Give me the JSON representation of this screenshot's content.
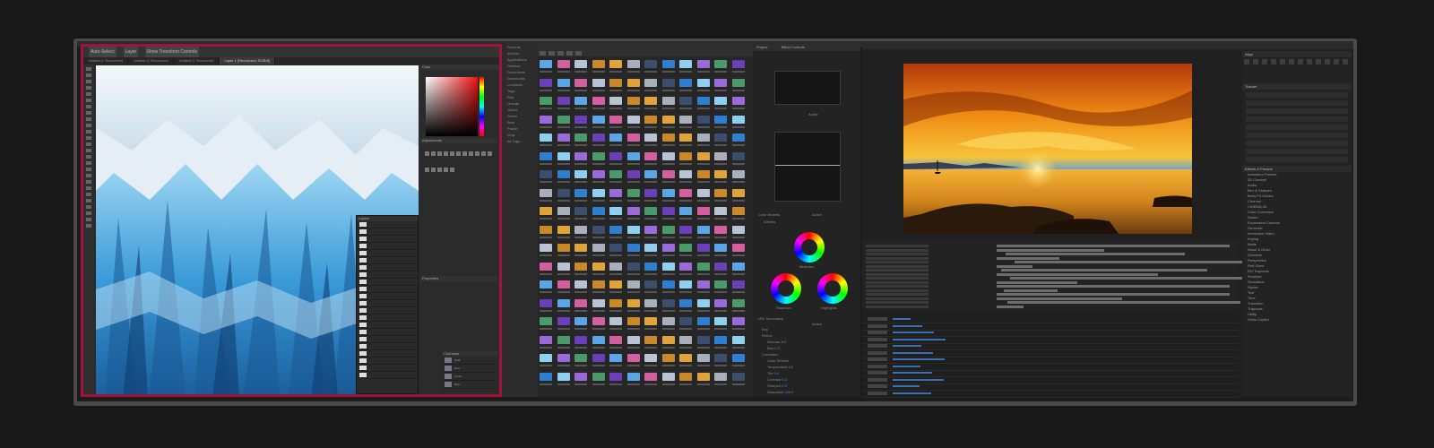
{
  "photoshop": {
    "option_buttons": [
      "Auto-Select:",
      "Layer",
      "Show Transform Controls"
    ],
    "tabs": [
      "Untitled-1, Recovered",
      "Untitled-2, Recovered",
      "Untitled-3, Recovered",
      "Layer 1 (Recovered, RGB/8)"
    ],
    "active_tab_index": 3,
    "panels": {
      "color": "Color",
      "adjustments": "Adjustments",
      "properties": "Properties",
      "layers": "Layers",
      "channels": "Channels"
    },
    "channels": [
      "RGB",
      "Red",
      "Green",
      "Blue"
    ],
    "highlight_color": "#a3123a"
  },
  "finder": {
    "sidebar": [
      "Recents",
      "AirDrop",
      "Applications",
      "Desktop",
      "Documents",
      "Downloads",
      "Locations",
      "Tags",
      "Red",
      "Orange",
      "Yellow",
      "Green",
      "Blue",
      "Purple",
      "Gray",
      "All Tags..."
    ]
  },
  "effect_controls": {
    "tabs": [
      "Project",
      "Effect Controls"
    ],
    "sections": {
      "color_wheels": "Color Wheels",
      "wheels": "Wheels",
      "hsl": "HSL Secondary",
      "key": "Key",
      "refine": "Refine",
      "correction": "Correction"
    },
    "wheel_labels": [
      "Midtones",
      "Shadows",
      "Highlights"
    ],
    "active_label": "Active",
    "params": [
      {
        "name": "Denoise",
        "value": "0.0"
      },
      {
        "name": "Blur",
        "value": "0.0"
      },
      {
        "name": "Temperature",
        "value": "0.0"
      },
      {
        "name": "Tint",
        "value": "0.0"
      },
      {
        "name": "Contrast",
        "value": "0.0"
      },
      {
        "name": "Sharpen",
        "value": "0.0"
      },
      {
        "name": "Saturation",
        "value": "100.0"
      }
    ]
  },
  "after_effects": {
    "panels": {
      "align": "Align",
      "tracker": "Tracker",
      "effects": "Effects & Presets"
    },
    "effects_list": [
      "Animation Presets",
      "3D Channel",
      "Audio",
      "Blur & Sharpen",
      "Boris FX Mocha",
      "Channel",
      "CINEMA 4D",
      "Color Correction",
      "Distort",
      "Expression Controls",
      "Generate",
      "Immersive Video",
      "Keying",
      "Matte",
      "Noise & Grain",
      "Obsolete",
      "Perspective",
      "Red Giant",
      "RG Trapcode",
      "Rowbyte",
      "Simulation",
      "Stylize",
      "Text",
      "Time",
      "Transition",
      "Trapcode",
      "Utility",
      "Video Copilot"
    ]
  }
}
